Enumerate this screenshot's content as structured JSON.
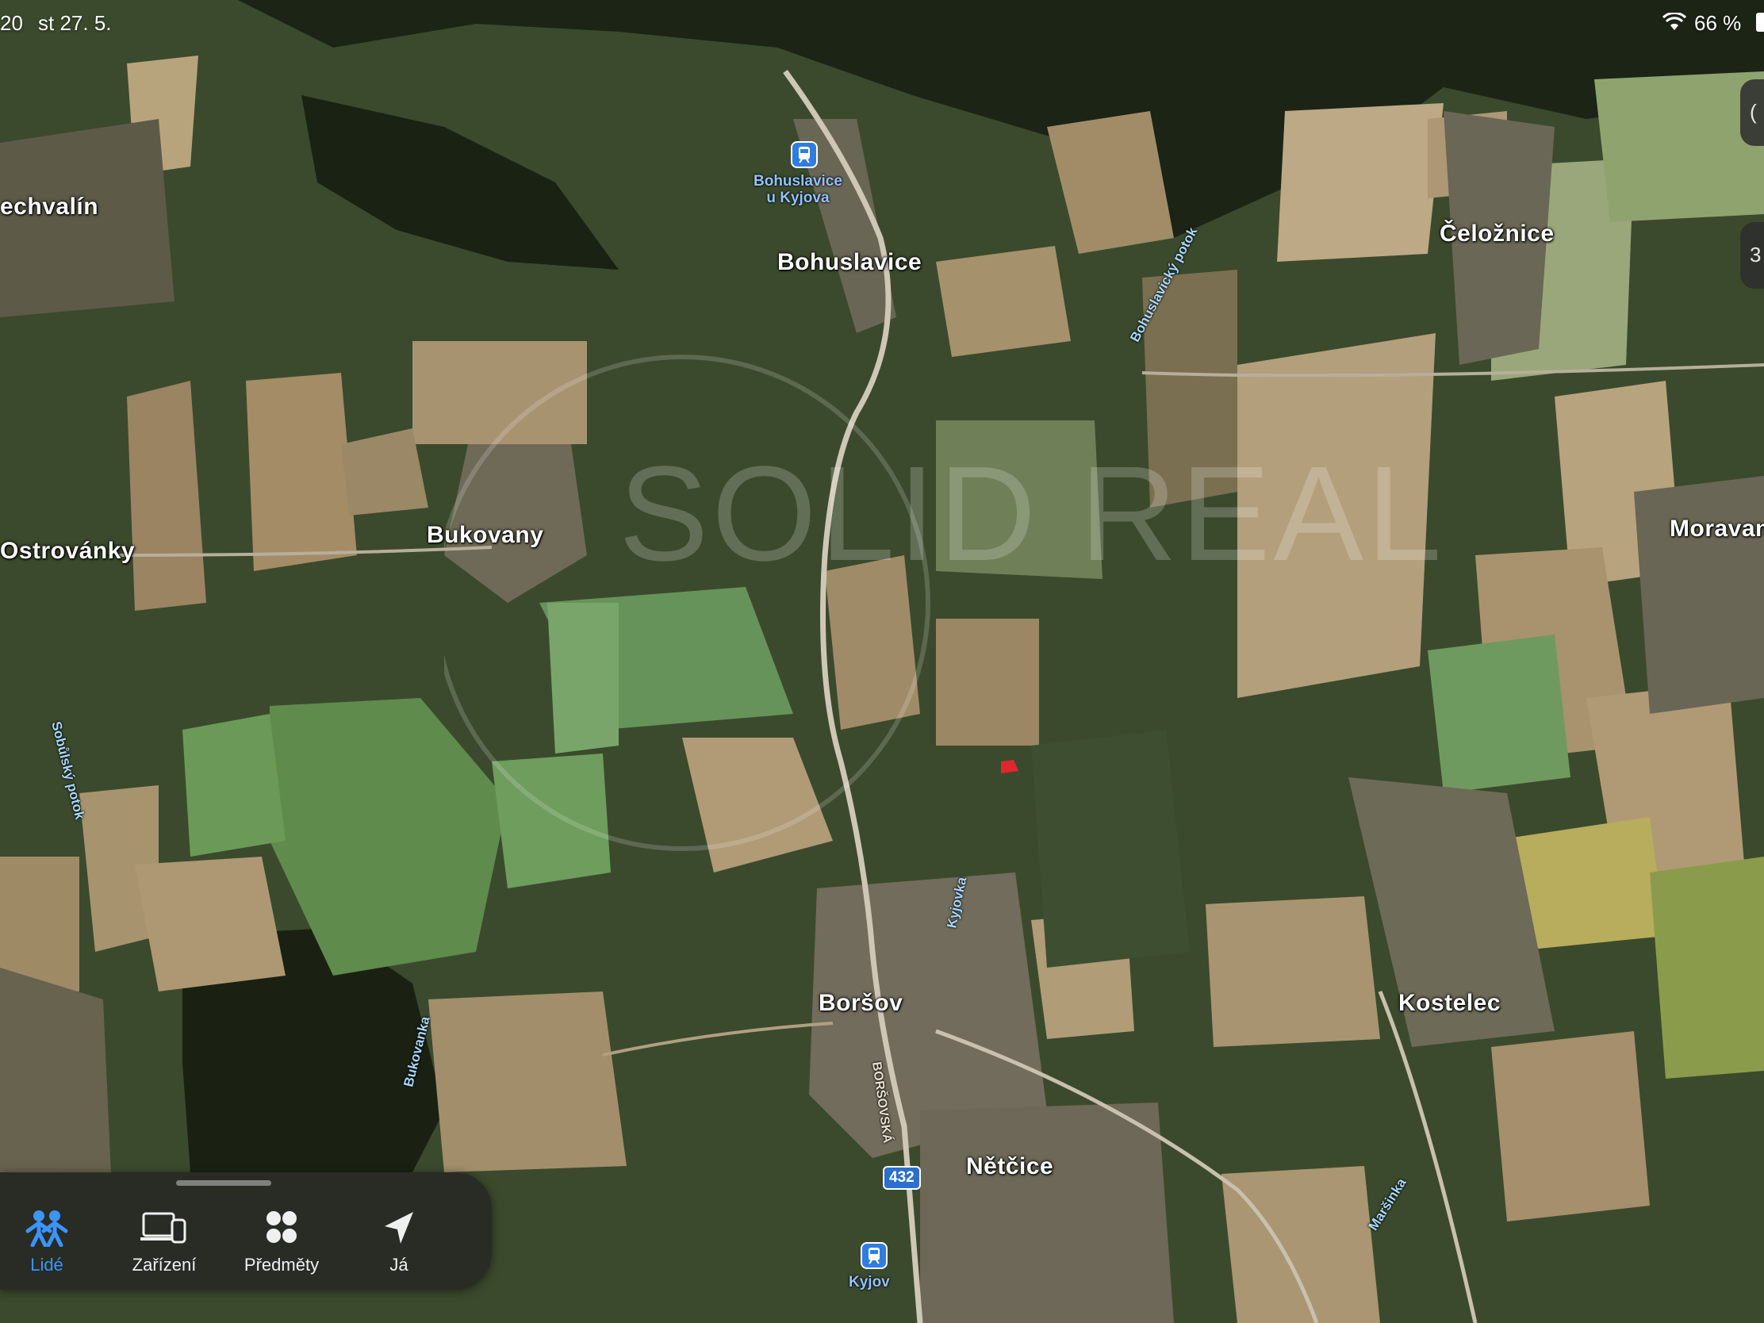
{
  "status_bar": {
    "time": "20",
    "date": "st 27. 5.",
    "battery": "66 %",
    "icons": [
      "wifi-icon",
      "battery-icon"
    ]
  },
  "map": {
    "towns": [
      "Bohuslavice",
      "Čeložnice",
      "Bukovany",
      "Ostrovánky",
      "Moravan",
      "Boršov",
      "Kostelec",
      "Nětčice",
      "echvalín"
    ],
    "stations": [
      {
        "name": "Bohuslavice\nu Kyjova",
        "icon": "train-icon"
      },
      {
        "name": "Kyjov",
        "icon": "train-icon"
      }
    ],
    "waterways": [
      "Bohuslavický potok",
      "Sobůlský potok",
      "Kyjovka",
      "Bukovanka",
      "Maršinka"
    ],
    "streets": [
      "BORŠOVSKÁ"
    ],
    "route_shield": "432",
    "watermark": "SOLID REAL",
    "map_controls": [
      "(",
      "3"
    ]
  },
  "tabbar": {
    "tabs": [
      {
        "label": "Lidé",
        "icon": "people-icon",
        "active": true
      },
      {
        "label": "Zařízení",
        "icon": "devices-icon",
        "active": false
      },
      {
        "label": "Předměty",
        "icon": "items-icon",
        "active": false
      },
      {
        "label": "Já",
        "icon": "location-arrow-icon",
        "active": false
      }
    ]
  },
  "colors": {
    "accent": "#3a95ff",
    "transit": "#2f7de1"
  }
}
